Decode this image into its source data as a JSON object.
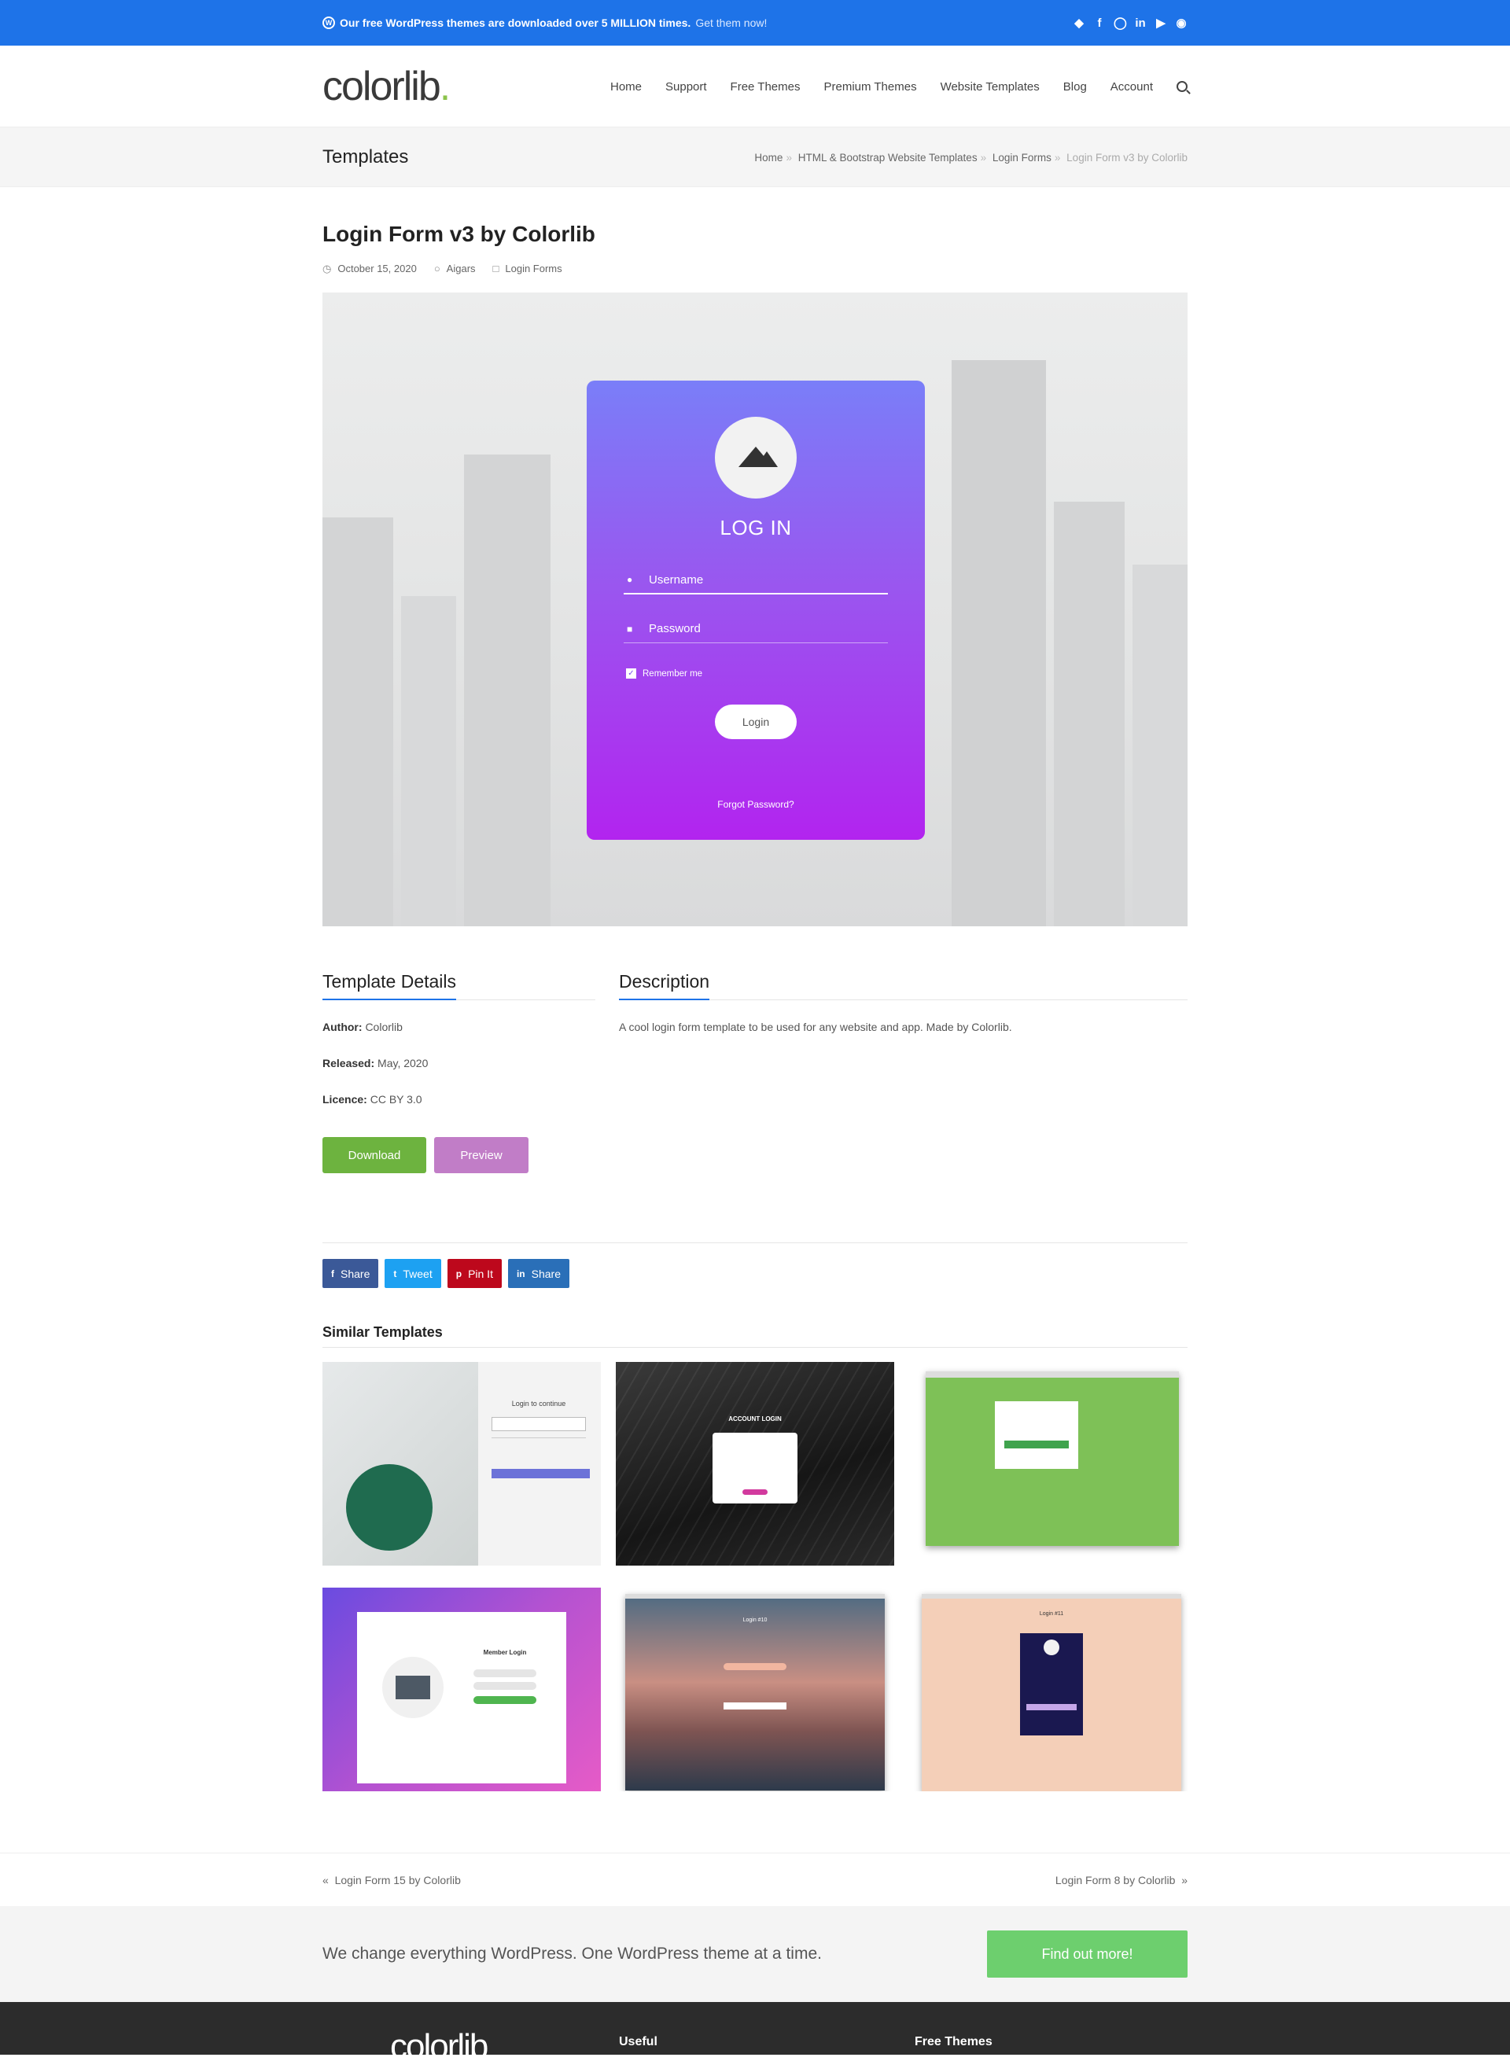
{
  "topbar": {
    "wp_glyph": "W",
    "message_bold": "Our free WordPress themes are downloaded over 5 MILLION times.",
    "message_link": "Get them now!",
    "social": [
      "twitter-icon",
      "facebook-icon",
      "instagram-icon",
      "linkedin-icon",
      "youtube-icon",
      "github-icon"
    ]
  },
  "header": {
    "logo": "colorlib",
    "logo_dot": ".",
    "nav": [
      "Home",
      "Support",
      "Free Themes",
      "Premium Themes",
      "Website Templates",
      "Blog",
      "Account"
    ]
  },
  "titlebar": {
    "title": "Templates",
    "crumbs": [
      "Home",
      "HTML & Bootstrap Website Templates",
      "Login Forms"
    ],
    "current": "Login Form v3 by Colorlib",
    "sep": "»"
  },
  "article": {
    "title": "Login Form v3 by Colorlib",
    "date": "October 15, 2020",
    "author": "Aigars",
    "category": "Login Forms"
  },
  "preview_form": {
    "title": "LOG IN",
    "username_placeholder": "Username",
    "password_placeholder": "Password",
    "remember": "Remember me",
    "login_button": "Login",
    "forgot": "Forgot Password?"
  },
  "details": {
    "heading": "Template Details",
    "author_label": "Author:",
    "author": "Colorlib",
    "released_label": "Released:",
    "released": "May, 2020",
    "licence_label": "Licence:",
    "licence": "CC BY 3.0",
    "download": "Download",
    "preview": "Preview"
  },
  "description": {
    "heading": "Description",
    "text": "A cool login form template to be used for any website and app. Made by Colorlib."
  },
  "share": [
    {
      "label": "Share",
      "icon": "f",
      "color": "#3b5998"
    },
    {
      "label": "Tweet",
      "icon": "t",
      "color": "#1da1f2"
    },
    {
      "label": "Pin It",
      "icon": "p",
      "color": "#bd081c"
    },
    {
      "label": "Share",
      "icon": "in",
      "color": "#2a6fb8"
    }
  ],
  "similar": {
    "heading": "Similar Templates",
    "t1_title": "Login to continue",
    "t2_title": "ACCOUNT LOGIN",
    "t4_title": "Member Login",
    "t5_title": "Login #10",
    "t6_title": "Login #11"
  },
  "post_nav": {
    "prev": "Login Form 15 by Colorlib",
    "next": "Login Form 8 by Colorlib"
  },
  "cta": {
    "text": "We change everything WordPress. One WordPress theme at a time.",
    "button": "Find out more!"
  },
  "footer": {
    "logo": "colorlib",
    "col1": "Useful",
    "col2": "Free Themes"
  }
}
